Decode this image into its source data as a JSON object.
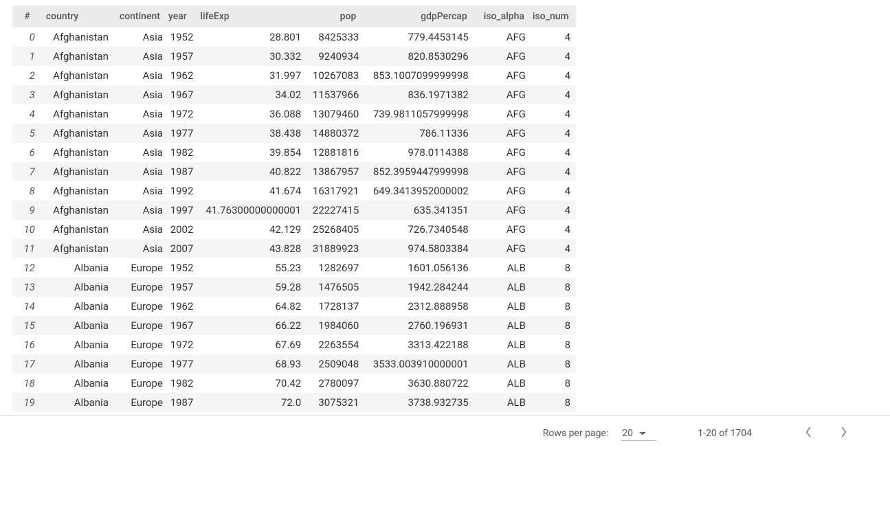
{
  "table": {
    "columns": [
      "#",
      "country",
      "continent",
      "year",
      "lifeExp",
      "pop",
      "gdpPercap",
      "iso_alpha",
      "iso_num"
    ],
    "rows": [
      {
        "idx": "0",
        "country": "Afghanistan",
        "continent": "Asia",
        "year": "1952",
        "lifeExp": "28.801",
        "pop": "8425333",
        "gdp": "779.4453145",
        "alpha": "AFG",
        "num": "4"
      },
      {
        "idx": "1",
        "country": "Afghanistan",
        "continent": "Asia",
        "year": "1957",
        "lifeExp": "30.332",
        "pop": "9240934",
        "gdp": "820.8530296",
        "alpha": "AFG",
        "num": "4"
      },
      {
        "idx": "2",
        "country": "Afghanistan",
        "continent": "Asia",
        "year": "1962",
        "lifeExp": "31.997",
        "pop": "10267083",
        "gdp": "853.1007099999998",
        "alpha": "AFG",
        "num": "4"
      },
      {
        "idx": "3",
        "country": "Afghanistan",
        "continent": "Asia",
        "year": "1967",
        "lifeExp": "34.02",
        "pop": "11537966",
        "gdp": "836.1971382",
        "alpha": "AFG",
        "num": "4"
      },
      {
        "idx": "4",
        "country": "Afghanistan",
        "continent": "Asia",
        "year": "1972",
        "lifeExp": "36.088",
        "pop": "13079460",
        "gdp": "739.9811057999998",
        "alpha": "AFG",
        "num": "4"
      },
      {
        "idx": "5",
        "country": "Afghanistan",
        "continent": "Asia",
        "year": "1977",
        "lifeExp": "38.438",
        "pop": "14880372",
        "gdp": "786.11336",
        "alpha": "AFG",
        "num": "4"
      },
      {
        "idx": "6",
        "country": "Afghanistan",
        "continent": "Asia",
        "year": "1982",
        "lifeExp": "39.854",
        "pop": "12881816",
        "gdp": "978.0114388",
        "alpha": "AFG",
        "num": "4"
      },
      {
        "idx": "7",
        "country": "Afghanistan",
        "continent": "Asia",
        "year": "1987",
        "lifeExp": "40.822",
        "pop": "13867957",
        "gdp": "852.3959447999998",
        "alpha": "AFG",
        "num": "4"
      },
      {
        "idx": "8",
        "country": "Afghanistan",
        "continent": "Asia",
        "year": "1992",
        "lifeExp": "41.674",
        "pop": "16317921",
        "gdp": "649.3413952000002",
        "alpha": "AFG",
        "num": "4"
      },
      {
        "idx": "9",
        "country": "Afghanistan",
        "continent": "Asia",
        "year": "1997",
        "lifeExp": "41.76300000000001",
        "pop": "22227415",
        "gdp": "635.341351",
        "alpha": "AFG",
        "num": "4"
      },
      {
        "idx": "10",
        "country": "Afghanistan",
        "continent": "Asia",
        "year": "2002",
        "lifeExp": "42.129",
        "pop": "25268405",
        "gdp": "726.7340548",
        "alpha": "AFG",
        "num": "4"
      },
      {
        "idx": "11",
        "country": "Afghanistan",
        "continent": "Asia",
        "year": "2007",
        "lifeExp": "43.828",
        "pop": "31889923",
        "gdp": "974.5803384",
        "alpha": "AFG",
        "num": "4"
      },
      {
        "idx": "12",
        "country": "Albania",
        "continent": "Europe",
        "year": "1952",
        "lifeExp": "55.23",
        "pop": "1282697",
        "gdp": "1601.056136",
        "alpha": "ALB",
        "num": "8"
      },
      {
        "idx": "13",
        "country": "Albania",
        "continent": "Europe",
        "year": "1957",
        "lifeExp": "59.28",
        "pop": "1476505",
        "gdp": "1942.284244",
        "alpha": "ALB",
        "num": "8"
      },
      {
        "idx": "14",
        "country": "Albania",
        "continent": "Europe",
        "year": "1962",
        "lifeExp": "64.82",
        "pop": "1728137",
        "gdp": "2312.888958",
        "alpha": "ALB",
        "num": "8"
      },
      {
        "idx": "15",
        "country": "Albania",
        "continent": "Europe",
        "year": "1967",
        "lifeExp": "66.22",
        "pop": "1984060",
        "gdp": "2760.196931",
        "alpha": "ALB",
        "num": "8"
      },
      {
        "idx": "16",
        "country": "Albania",
        "continent": "Europe",
        "year": "1972",
        "lifeExp": "67.69",
        "pop": "2263554",
        "gdp": "3313.422188",
        "alpha": "ALB",
        "num": "8"
      },
      {
        "idx": "17",
        "country": "Albania",
        "continent": "Europe",
        "year": "1977",
        "lifeExp": "68.93",
        "pop": "2509048",
        "gdp": "3533.003910000001",
        "alpha": "ALB",
        "num": "8"
      },
      {
        "idx": "18",
        "country": "Albania",
        "continent": "Europe",
        "year": "1982",
        "lifeExp": "70.42",
        "pop": "2780097",
        "gdp": "3630.880722",
        "alpha": "ALB",
        "num": "8"
      },
      {
        "idx": "19",
        "country": "Albania",
        "continent": "Europe",
        "year": "1987",
        "lifeExp": "72.0",
        "pop": "3075321",
        "gdp": "3738.932735",
        "alpha": "ALB",
        "num": "8"
      }
    ]
  },
  "footer": {
    "rows_per_page_label": "Rows per page:",
    "rows_per_page_value": "20",
    "range": "1-20 of 1704"
  }
}
